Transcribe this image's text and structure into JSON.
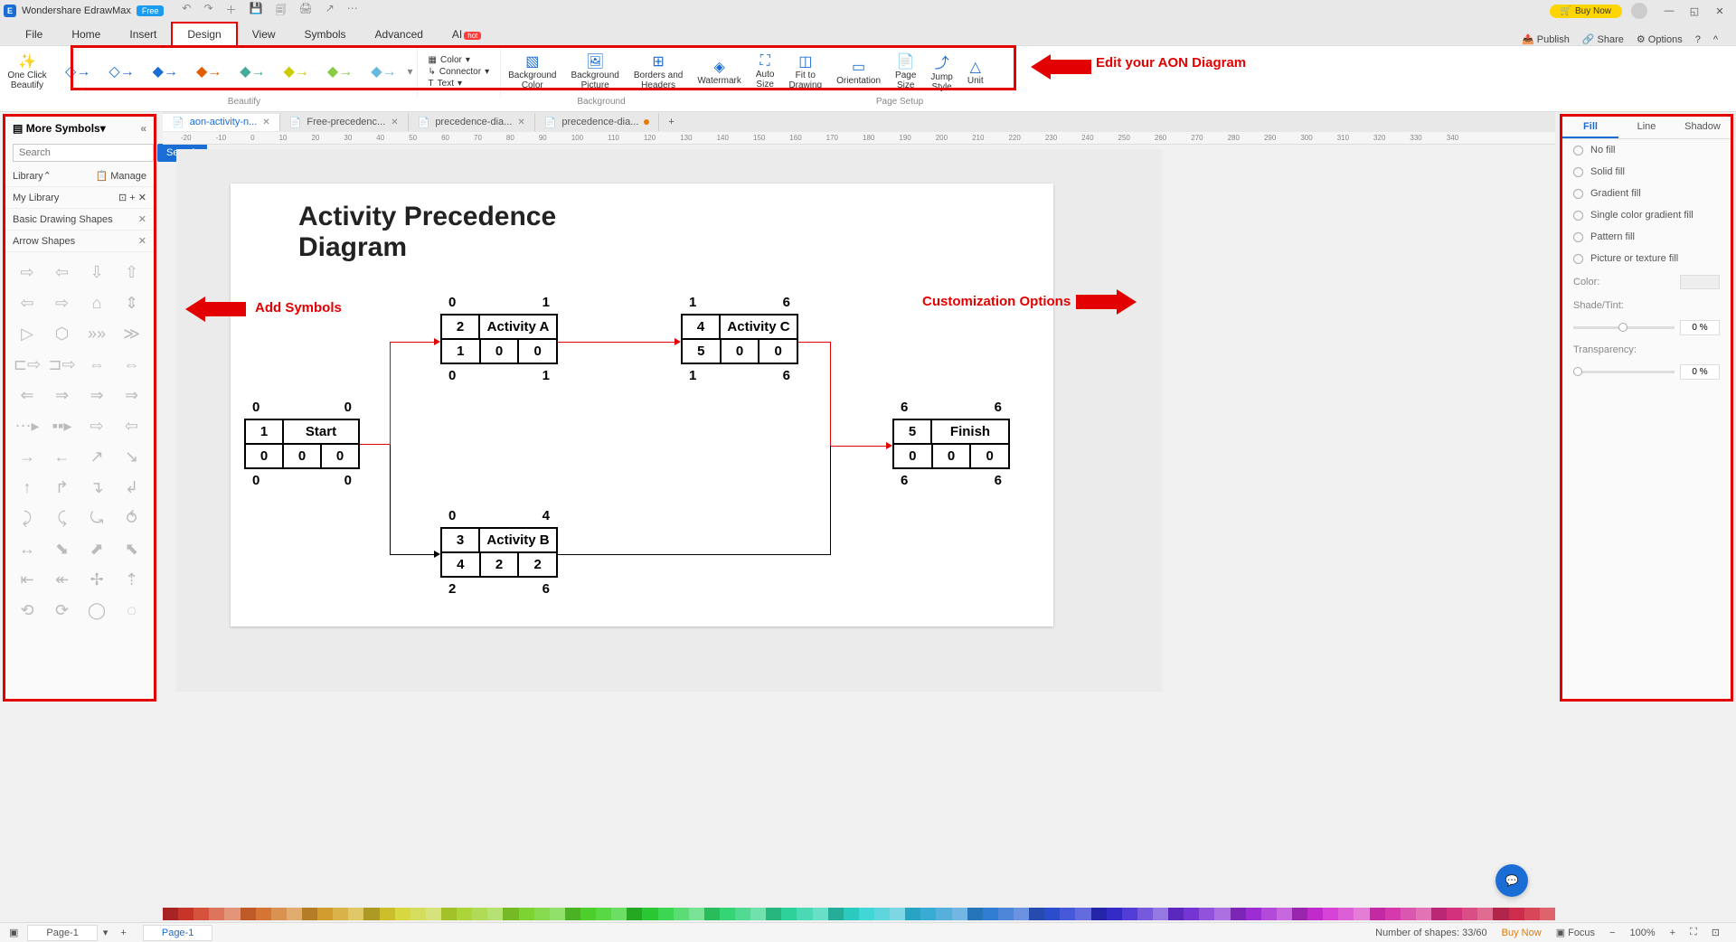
{
  "app": {
    "title": "Wondershare EdrawMax",
    "free": "Free",
    "buy_now": "Buy Now"
  },
  "menu": {
    "items": [
      "File",
      "Home",
      "Insert",
      "Design",
      "View",
      "Symbols",
      "Advanced",
      "AI"
    ],
    "active_index": 3,
    "right": {
      "publish": "Publish",
      "share": "Share",
      "options": "Options"
    }
  },
  "ribbon": {
    "one_click": "One Click\nBeautify",
    "color": "Color",
    "connector": "Connector",
    "text": "Text",
    "bg_color": "Background\nColor",
    "bg_picture": "Background\nPicture",
    "borders": "Borders and\nHeaders",
    "watermark": "Watermark",
    "auto_size": "Auto\nSize",
    "fit": "Fit to\nDrawing",
    "orientation": "Orientation",
    "page_size": "Page\nSize",
    "jump_style": "Jump\nStyle",
    "unit": "Unit",
    "section_beautify": "Beautify",
    "section_background": "Background",
    "section_page": "Page Setup"
  },
  "left_pane": {
    "title": "More Symbols",
    "search_placeholder": "Search",
    "search_btn": "Search",
    "library": "Library",
    "manage": "Manage",
    "my_library": "My Library",
    "basic_shapes": "Basic Drawing Shapes",
    "arrow_shapes": "Arrow Shapes"
  },
  "doc_tabs": [
    {
      "label": "aon-activity-n...",
      "active": true
    },
    {
      "label": "Free-precedenc...",
      "active": false
    },
    {
      "label": "precedence-dia...",
      "active": false
    },
    {
      "label": "precedence-dia...",
      "active": false,
      "modified": true
    }
  ],
  "ruler_marks": [
    "-20",
    "-10",
    "0",
    "10",
    "20",
    "30",
    "40",
    "50",
    "60",
    "70",
    "80",
    "90",
    "100",
    "110",
    "120",
    "130",
    "140",
    "150",
    "160",
    "170",
    "180",
    "190",
    "200",
    "210",
    "220",
    "230",
    "240",
    "250",
    "260",
    "270",
    "280",
    "290",
    "300",
    "310",
    "320",
    "330",
    "340"
  ],
  "diagram": {
    "title": "Activity Precedence\nDiagram",
    "nodes": {
      "start": {
        "top_l": "0",
        "top_r": "0",
        "r1": [
          "1",
          "Start"
        ],
        "r2": [
          "0",
          "0",
          "0"
        ],
        "bot_l": "0",
        "bot_r": "0"
      },
      "a": {
        "top_l": "0",
        "top_r": "1",
        "r1": [
          "2",
          "Activity A"
        ],
        "r2": [
          "1",
          "0",
          "0"
        ],
        "bot_l": "0",
        "bot_r": "1"
      },
      "b": {
        "top_l": "0",
        "top_r": "4",
        "r1": [
          "3",
          "Activity B"
        ],
        "r2": [
          "4",
          "2",
          "2"
        ],
        "bot_l": "2",
        "bot_r": "6"
      },
      "c": {
        "top_l": "1",
        "top_r": "6",
        "r1": [
          "4",
          "Activity C"
        ],
        "r2": [
          "5",
          "0",
          "0"
        ],
        "bot_l": "1",
        "bot_r": "6"
      },
      "finish": {
        "top_l": "6",
        "top_r": "6",
        "r1": [
          "5",
          "Finish"
        ],
        "r2": [
          "0",
          "0",
          "0"
        ],
        "bot_l": "6",
        "bot_r": "6"
      }
    }
  },
  "right_pane": {
    "tabs": [
      "Fill",
      "Line",
      "Shadow"
    ],
    "active_tab": 0,
    "fill_options": [
      "No fill",
      "Solid fill",
      "Gradient fill",
      "Single color gradient fill",
      "Pattern fill",
      "Picture or texture fill"
    ],
    "color_lbl": "Color:",
    "shade_lbl": "Shade/Tint:",
    "shade_val": "0 %",
    "trans_lbl": "Transparency:",
    "trans_val": "0 %"
  },
  "annotations": {
    "edit_diagram": "Edit your AON Diagram",
    "add_symbols": "Add Symbols",
    "customization": "Customization Options"
  },
  "status": {
    "page_label": "Page-1",
    "page_tab": "Page-1",
    "shapes": "Number of shapes: 33/60",
    "buy_now": "Buy Now",
    "focus": "Focus",
    "zoom": "100%"
  },
  "color_palette": [
    "#000",
    "#e20000",
    "#e25c00",
    "#e29800",
    "#e2d400",
    "#b4e200",
    "#78e200",
    "#3ce200",
    "#00e200",
    "#00e23c",
    "#00e278",
    "#00e2b4",
    "#00e2e2",
    "#00b4e2",
    "#0078e2",
    "#003ce2",
    "#0000e2",
    "#3c00e2",
    "#7800e2",
    "#b400e2",
    "#e200e2",
    "#e200b4",
    "#e20078",
    "#e2003c",
    "#806040",
    "#605040",
    "#404040",
    "#808080",
    "#c0c0c0",
    "#fff"
  ]
}
